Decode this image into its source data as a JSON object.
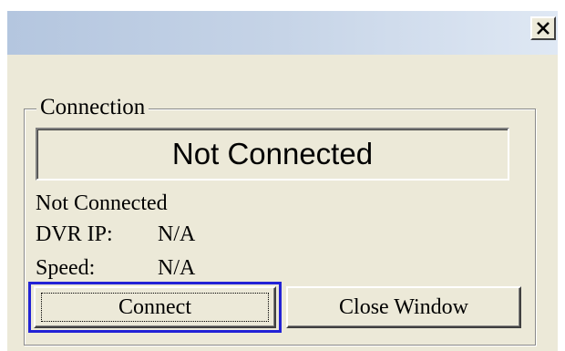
{
  "titlebar": {
    "close_icon": "close-x-icon"
  },
  "connection": {
    "group_label": "Connection",
    "status_banner": "Not Connected",
    "status_text": "Not Connected",
    "dvr_ip_label": "DVR IP:",
    "dvr_ip_value": "N/A",
    "speed_label": "Speed:",
    "speed_value": "N/A"
  },
  "buttons": {
    "connect_label": "Connect",
    "close_window_label": "Close Window"
  },
  "colors": {
    "window_bg": "#ece9d8",
    "focus_ring": "#2323d6",
    "titlebar_start": "#b4c6df",
    "titlebar_end": "#dfe8f4"
  }
}
